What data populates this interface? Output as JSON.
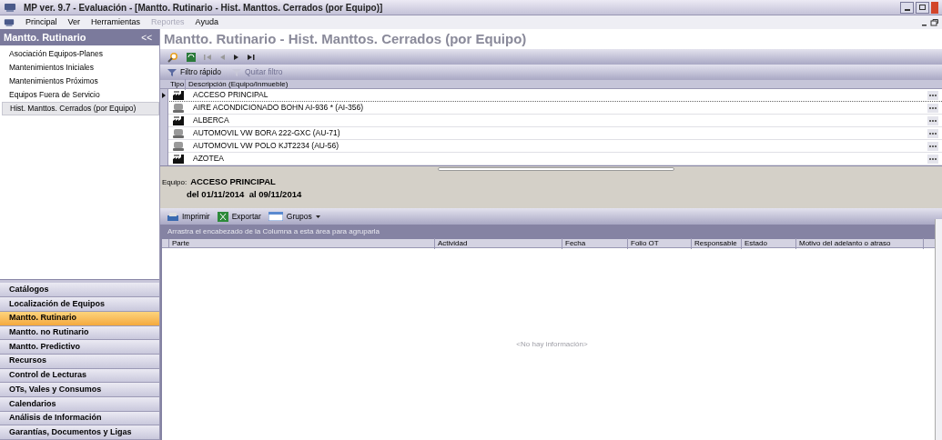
{
  "window": {
    "title": "MP ver. 9.7 - Evaluación - [Mantto. Rutinario - Hist. Manttos. Cerrados (por Equipo)]"
  },
  "menu": [
    {
      "label": "Principal",
      "disabled": false
    },
    {
      "label": "Ver",
      "disabled": false
    },
    {
      "label": "Herramientas",
      "disabled": false
    },
    {
      "label": "Reportes",
      "disabled": true
    },
    {
      "label": "Ayuda",
      "disabled": false
    }
  ],
  "sidebar": {
    "title": "Mantto. Rutinario",
    "collapse": "<<",
    "items": [
      {
        "label": "Asociación Equipos-Planes",
        "selected": false
      },
      {
        "label": "Mantenimientos Iniciales",
        "selected": false
      },
      {
        "label": "Mantenimientos Próximos",
        "selected": false
      },
      {
        "label": "Equipos Fuera de Servicio",
        "selected": false
      },
      {
        "label": "Hist. Manttos. Cerrados (por Equipo)",
        "selected": true
      }
    ],
    "modules": [
      {
        "label": "Catálogos",
        "selected": false
      },
      {
        "label": "Localización de Equipos",
        "selected": false
      },
      {
        "label": "Mantto. Rutinario",
        "selected": true
      },
      {
        "label": "Mantto. no Rutinario",
        "selected": false
      },
      {
        "label": "Mantto. Predictivo",
        "selected": false
      },
      {
        "label": "Recursos",
        "selected": false
      },
      {
        "label": "Control de Lecturas",
        "selected": false
      },
      {
        "label": "OTs, Vales y Consumos",
        "selected": false
      },
      {
        "label": "Calendarios",
        "selected": false
      },
      {
        "label": "Análisis de Información",
        "selected": false
      },
      {
        "label": "Garantías, Documentos y Ligas",
        "selected": false
      }
    ]
  },
  "main": {
    "title": "Mantto. Rutinario - Hist. Manttos. Cerrados (por Equipo)",
    "filters": [
      {
        "label": "Filtro rápido",
        "disabled": false
      },
      {
        "label": "Quitar filtro",
        "disabled": true
      }
    ],
    "equipment_table": {
      "columns": [
        "Tipo",
        "Descripción (Equipo/Inmueble)"
      ],
      "rows": [
        {
          "kind": "building",
          "description": "ACCESO PRINCIPAL",
          "selected": true
        },
        {
          "kind": "device",
          "description": "AIRE ACONDICIONADO BOHN AI-936 * (AI-356)",
          "selected": false
        },
        {
          "kind": "building",
          "description": "ALBERCA",
          "selected": false
        },
        {
          "kind": "device",
          "description": "AUTOMOVIL VW BORA 222-GXC (AU-71)",
          "selected": false
        },
        {
          "kind": "device",
          "description": "AUTOMOVIL VW POLO KJT2234 (AU-56)",
          "selected": false
        },
        {
          "kind": "building",
          "description": "AZOTEA",
          "selected": false
        }
      ]
    },
    "detail": {
      "label": "Equipo:",
      "name": "ACCESO PRINCIPAL",
      "period": "del 01/11/2014  al 09/11/2014"
    },
    "actions": [
      "Imprimir",
      "Exportar",
      "Grupos"
    ],
    "group_hint": "Arrastra el encabezado de la Columna a esta área para agruparla",
    "history_table": {
      "columns": [
        "Parte",
        "Actividad",
        "Fecha",
        "Folio OT",
        "Responsable",
        "Estado",
        "Motivo del adelanto o atraso"
      ],
      "empty_message": "<No hay información>"
    }
  }
}
